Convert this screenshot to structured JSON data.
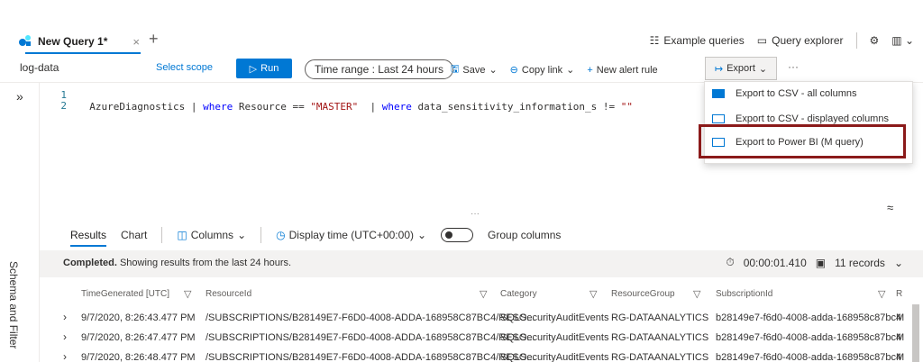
{
  "tab": {
    "title": "New Query 1*",
    "close": "×",
    "add": "+"
  },
  "top_right": {
    "example_queries": "Example queries",
    "query_explorer": "Query explorer"
  },
  "toolbar": {
    "scope": "log-data",
    "select_scope": "Select scope",
    "run": "Run",
    "time_range": "Time range : Last 24 hours",
    "save": "Save",
    "copy_link": "Copy link",
    "new_alert_rule": "New alert rule",
    "export": "Export",
    "more": "···"
  },
  "editor": {
    "line1": "1",
    "line2": "2",
    "code_parts": [
      "AzureDiagnostics | ",
      "where",
      " Resource == ",
      "\"MASTER\"",
      "  | ",
      "where",
      " data_sensitivity_information_s != ",
      "\"\""
    ]
  },
  "schema_label": "Schema and Filter",
  "results": {
    "tabs": [
      "Results",
      "Chart"
    ],
    "columns": "Columns",
    "display_time": "Display time (UTC+00:00)",
    "group_columns": "Group columns",
    "status_bold": "Completed.",
    "status_rest": " Showing results from the last 24 hours.",
    "duration": "00:00:01.410",
    "records": "11 records"
  },
  "table": {
    "headers": [
      "TimeGenerated [UTC]",
      "ResourceId",
      "Category",
      "ResourceGroup",
      "SubscriptionId",
      "R"
    ],
    "rows": [
      [
        "9/7/2020, 8:26:43.477 PM",
        "/SUBSCRIPTIONS/B28149E7-F6D0-4008-ADDA-168958C87BC4/RESO...",
        "SQLSecurityAuditEvents",
        "RG-DATAANALYTICS",
        "b28149e7-f6d0-4008-adda-168958c87bc4",
        "M"
      ],
      [
        "9/7/2020, 8:26:47.477 PM",
        "/SUBSCRIPTIONS/B28149E7-F6D0-4008-ADDA-168958C87BC4/RESO...",
        "SQLSecurityAuditEvents",
        "RG-DATAANALYTICS",
        "b28149e7-f6d0-4008-adda-168958c87bc4",
        "M"
      ],
      [
        "9/7/2020, 8:26:48.477 PM",
        "/SUBSCRIPTIONS/B28149E7-F6D0-4008-ADDA-168958C87BC4/RESO...",
        "SQLSecurityAuditEvents",
        "RG-DATAANALYTICS",
        "b28149e7-f6d0-4008-adda-168958c87bc4",
        "M"
      ]
    ]
  },
  "export_menu": [
    "Export to CSV - all columns",
    "Export to CSV - displayed columns",
    "Export to Power BI (M query)"
  ],
  "colors": {
    "accent": "#0078d4",
    "highlight": "#8b1a1a"
  }
}
